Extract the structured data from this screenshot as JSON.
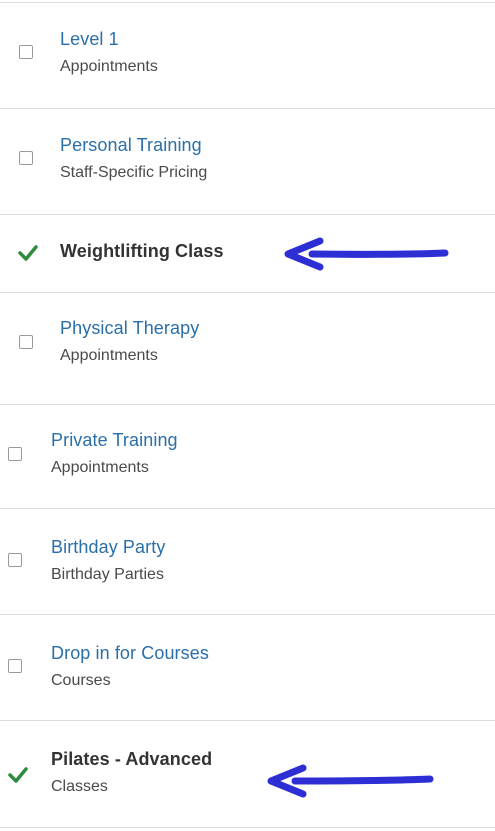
{
  "items": [
    {
      "title": "Level 1",
      "subtitle": "Appointments",
      "checked": false
    },
    {
      "title": "Personal Training",
      "subtitle": "Staff-Specific Pricing",
      "checked": false
    },
    {
      "title": "Weightlifting Class",
      "subtitle": "",
      "checked": true
    },
    {
      "title": "Physical Therapy",
      "subtitle": "Appointments",
      "checked": false
    },
    {
      "title": "Private Training",
      "subtitle": "Appointments",
      "checked": false
    },
    {
      "title": "Birthday Party",
      "subtitle": "Birthday Parties",
      "checked": false
    },
    {
      "title": "Drop in for Courses",
      "subtitle": "Courses",
      "checked": false
    },
    {
      "title": "Pilates - Advanced",
      "subtitle": "Classes",
      "checked": true
    }
  ],
  "colors": {
    "link": "#2a6fa8",
    "selected_text": "#333333",
    "check": "#2e8b3e",
    "arrow": "#2d2fd4",
    "divider": "#dcdcdc"
  },
  "icons": {
    "selected": "checkmark-icon",
    "unselected": "checkbox-icon",
    "annotation": "arrow-left-icon"
  }
}
